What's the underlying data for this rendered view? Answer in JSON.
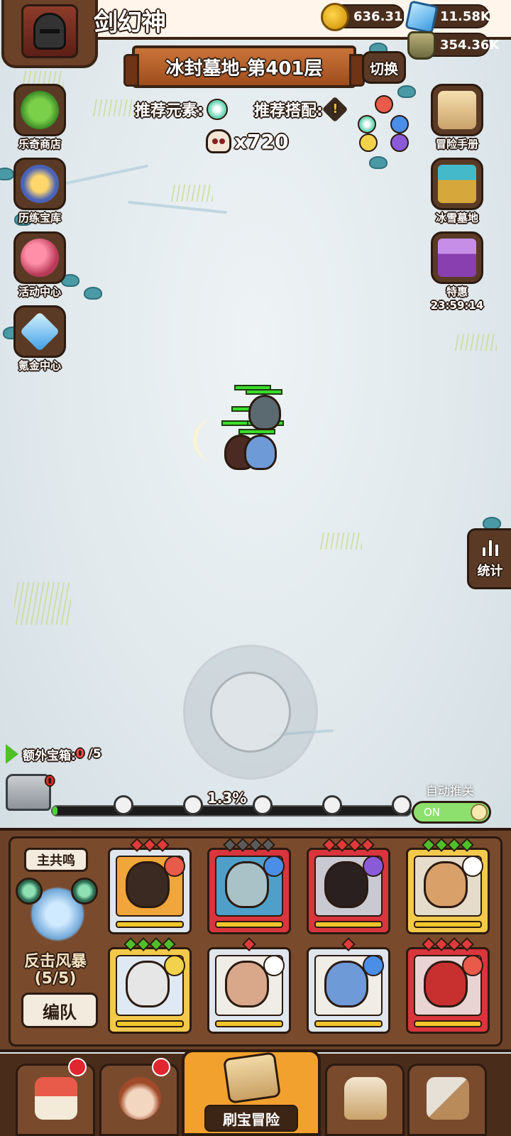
{
  "player": {
    "name": "剑幻神",
    "avatar_icon": "knight-helmet-icon"
  },
  "resources": {
    "gold": "636.31K",
    "gems": "11.58K",
    "potion": "354.36K"
  },
  "stage": {
    "title": "冰封墓地-第401层",
    "switch_label": "切换",
    "recommend_element_label": "推荐元素:",
    "recommend_combo_label": "推荐搭配:",
    "kill_count": "x720"
  },
  "left_menu": [
    {
      "label": "乐奇商店",
      "icon": "clover-icon"
    },
    {
      "label": "历练宝库",
      "icon": "treasure-vault-icon"
    },
    {
      "label": "活动中心",
      "icon": "bouquet-icon"
    },
    {
      "label": "氪金中心",
      "icon": "diamond-icon"
    }
  ],
  "right_menu": [
    {
      "label": "冒险手册",
      "icon": "scroll-icon"
    },
    {
      "label": "冰雪墓地",
      "icon": "ice-chest-icon"
    },
    {
      "label": "特惠",
      "timer": "23:59:14",
      "icon": "gift-chest-icon"
    }
  ],
  "stats_label": "统计",
  "extra_chest": {
    "label_prefix": "额外宝箱: ",
    "current": "0",
    "total": "/5",
    "chest_badge": "0"
  },
  "progress": {
    "label": "1.3%",
    "value_percent": 1.3
  },
  "auto": {
    "label": "自动推关",
    "toggle": "ON"
  },
  "team": {
    "resonance_tag": "主共鸣",
    "skill_name": "反击风暴",
    "skill_count": "(5/5)",
    "lineup_button": "编队",
    "heroes": [
      {
        "element": "fire-icon",
        "frame": "silver"
      },
      {
        "element": "water-icon",
        "frame": "red"
      },
      {
        "element": "dark-icon",
        "frame": "red"
      },
      {
        "element": "wind-icon",
        "frame": "gold"
      },
      {
        "element": "light-icon",
        "frame": "gold"
      },
      {
        "element": "wind-icon",
        "frame": "silver"
      },
      {
        "element": "water-icon",
        "frame": "silver"
      },
      {
        "element": "fire-icon",
        "frame": "red"
      }
    ]
  },
  "bottom_nav": {
    "main_label": "刷宝冒险"
  },
  "colors": {
    "accent_orange": "#f3a12e",
    "panel_brown": "#6b4128",
    "hp_green": "#3bdc2b"
  }
}
